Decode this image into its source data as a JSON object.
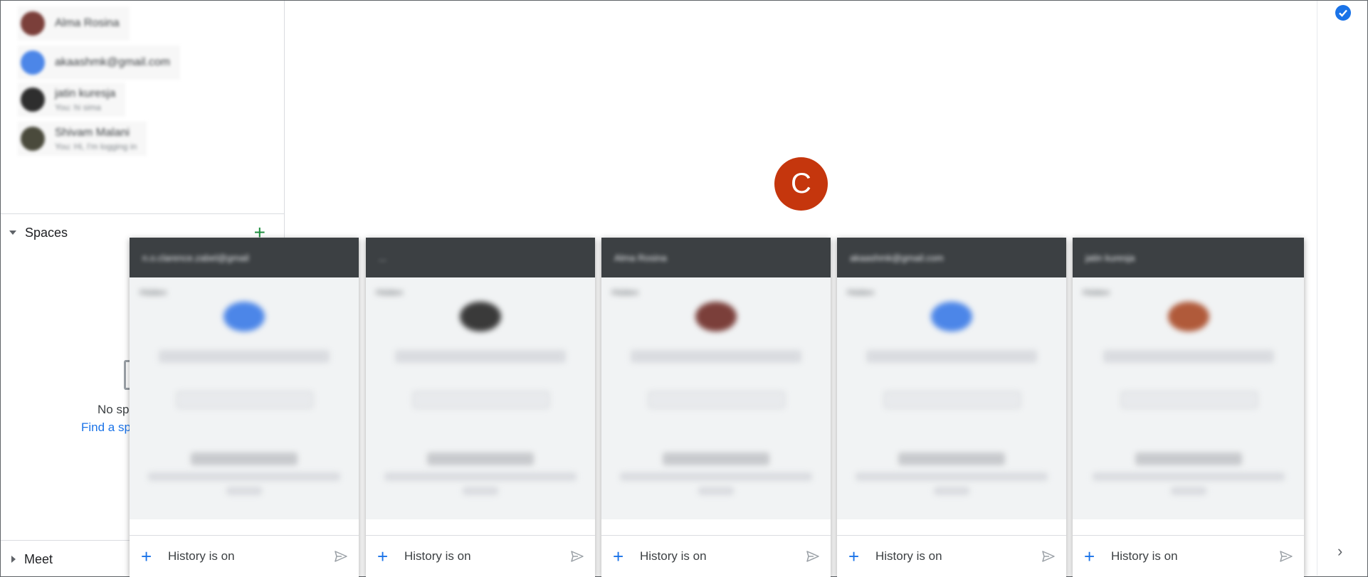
{
  "sidebar": {
    "dms": [
      {
        "name": "Alma Rosina",
        "sub": "",
        "color": "#7b3f3a"
      },
      {
        "name": "akaashmk@gmail.com",
        "sub": "",
        "color": "#4c86e8"
      },
      {
        "name": "jatin kuresja",
        "sub": "You: hi sima",
        "color": "#2e2e2e"
      },
      {
        "name": "Shivam Malani",
        "sub": "You: Hi, I'm logging in",
        "color": "#4a4a3c"
      }
    ],
    "spaces_label": "Spaces",
    "empty_text": "No sp",
    "empty_link": "Find a sp",
    "meet_label": "Meet"
  },
  "main": {
    "avatar_letter": "C",
    "avatar_color": "#c5360d"
  },
  "chat_windows": [
    {
      "header": "n.o.clarence.zabel@gmail",
      "tag": "Hidden",
      "avatar_color": "#4c86e8",
      "name": "clarence.zabel@gmail.com",
      "footer": "History is on",
      "card": "SHOW/CODE"
    },
    {
      "header": "...",
      "tag": "Hidden",
      "avatar_color": "#3a3a3a",
      "name": "Dee",
      "footer": "History is on",
      "card": "SHOW/CODE"
    },
    {
      "header": "Alma Rosina",
      "tag": "Hidden",
      "avatar_color": "#7b3f3a",
      "name": "Alma Rosina",
      "footer": "History is on",
      "card": "SHOW/CODE"
    },
    {
      "header": "akaashmk@gmail.com",
      "tag": "Hidden",
      "avatar_color": "#4c86e8",
      "name": "akaashmk@gmail.com",
      "footer": "History is on",
      "card": "SHOW/CODE"
    },
    {
      "header": "jatin kuresja",
      "tag": "Hidden",
      "avatar_color": "#b05a3a",
      "name": "Bhavesh Daharia",
      "footer": "History is on",
      "card": "SHOW/CODE"
    }
  ]
}
